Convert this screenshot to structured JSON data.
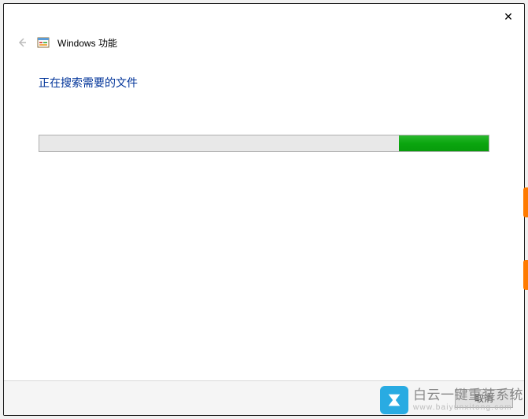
{
  "window": {
    "title": "Windows 功能",
    "close_symbol": "✕"
  },
  "content": {
    "status_text": "正在搜索需要的文件"
  },
  "progress": {
    "segment_start_pct": 80,
    "segment_width_pct": 20
  },
  "footer": {
    "cancel_label": "取消"
  },
  "watermark": {
    "main": "白云一键重装系统",
    "sub": "www.baiyunxitong.com"
  }
}
